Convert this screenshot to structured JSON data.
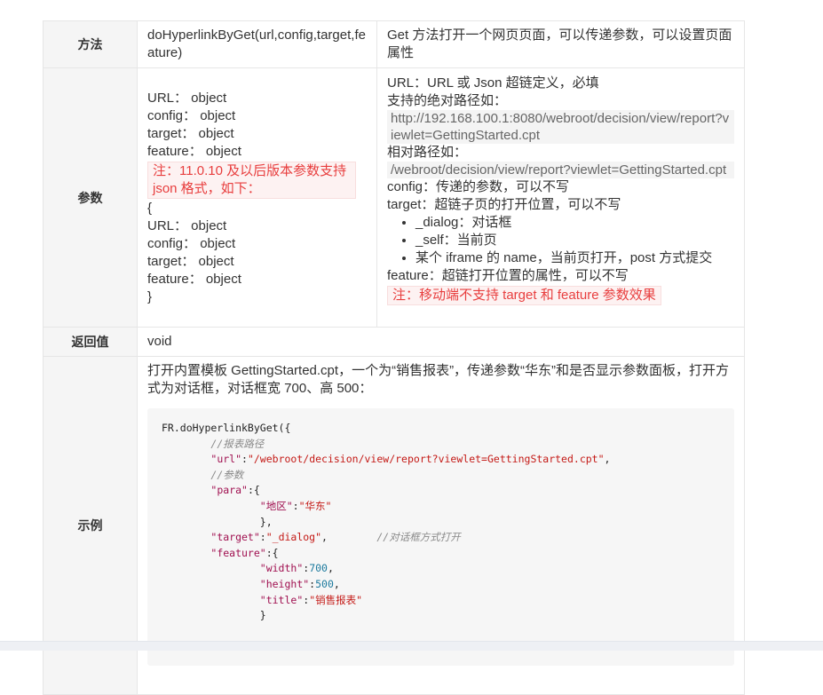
{
  "rows": {
    "method": {
      "label": "方法",
      "signature": "doHyperlinkByGet(url,config,target,feature)",
      "description": "Get 方法打开一个网页页面，可以传递参数，可以设置页面属性"
    },
    "params": {
      "label": "参数",
      "left_lines_1": [
        "URL： object",
        "config： object",
        "target： object",
        "feature： object"
      ],
      "note": "注：11.0.10 及以后版本参数支持 json 格式，如下：",
      "left_lines_2": [
        "{",
        "URL： object",
        "config： object",
        "target： object",
        "feature： object",
        "}"
      ],
      "right": {
        "url_desc": "URL：URL 或 Json 超链定义，必填",
        "abs_label": "支持的绝对路径如：",
        "abs_path": "http://192.168.100.1:8080/webroot/decision/view/report?viewlet=GettingStarted.cpt",
        "rel_label": "相对路径如：",
        "rel_path": "/webroot/decision/view/report?viewlet=GettingStarted.cpt",
        "config_desc": "config：传递的参数，可以不写",
        "target_desc": "target：超链子页的打开位置，可以不写",
        "target_options": [
          "_dialog：对话框",
          "_self：当前页",
          "某个 iframe 的 name，当前页打开，post 方式提交"
        ],
        "feature_desc": "feature：超链打开位置的属性，可以不写",
        "mobile_note": "注：移动端不支持 target 和 feature 参数效果"
      }
    },
    "return": {
      "label": "返回值",
      "value": "void"
    },
    "example": {
      "label": "示例",
      "description": "打开内置模板 GettingStarted.cpt，一个为“销售报表”，传递参数“华东”和是否显示参数面板，打开方式为对话框，对话框宽 700、高 500：",
      "code": {
        "l1": "FR.doHyperlinkByGet({",
        "c_path": "//报表路径",
        "k_url": "\"url\"",
        "v_url": "\"/webroot/decision/view/report?viewlet=GettingStarted.cpt\"",
        "c_para": "//参数",
        "k_para": "\"para\"",
        "k_area": "\"地区\"",
        "v_area": "\"华东\"",
        "k_target": "\"target\"",
        "v_target": "\"_dialog\"",
        "c_target": "//对话框方式打开",
        "k_feature": "\"feature\"",
        "k_width": "\"width\"",
        "v_width": "700",
        "k_height": "\"height\"",
        "v_height": "500",
        "k_title": "\"title\"",
        "v_title": "\"销售报表\""
      }
    }
  }
}
